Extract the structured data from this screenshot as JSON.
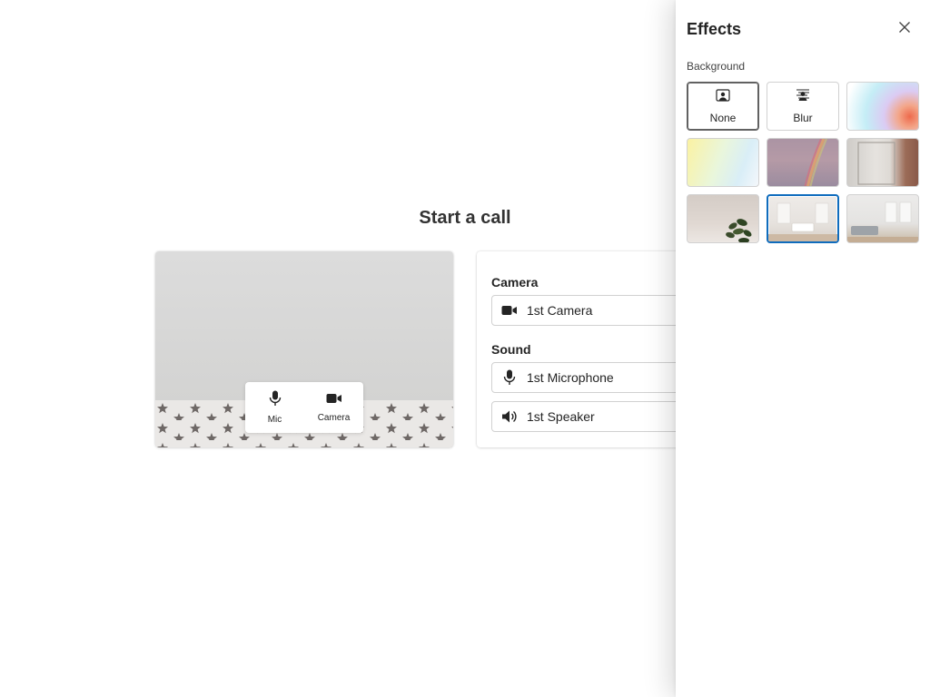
{
  "page": {
    "title": "Start a call"
  },
  "preview_controls": {
    "mic_label": "Mic",
    "camera_label": "Camera"
  },
  "settings": {
    "camera_section": "Camera",
    "camera_value": "1st Camera",
    "sound_section": "Sound",
    "microphone_value": "1st Microphone",
    "speaker_value": "1st Speaker"
  },
  "effects": {
    "title": "Effects",
    "background_label": "Background",
    "options": [
      {
        "label": "None",
        "icon": "person-frame-icon",
        "selected": true
      },
      {
        "label": "Blur",
        "icon": "blur-icon",
        "selected": false
      }
    ],
    "images": [
      {
        "name": "gradient-blue-orange",
        "selected": false
      },
      {
        "name": "pastel-gradient",
        "selected": false
      },
      {
        "name": "rainbow-sky",
        "selected": false
      },
      {
        "name": "mirror-room",
        "selected": false
      },
      {
        "name": "plant-wall",
        "selected": false
      },
      {
        "name": "white-bedroom",
        "selected": true
      },
      {
        "name": "living-room",
        "selected": false
      }
    ]
  },
  "colors": {
    "accent": "#0f6cbd",
    "text": "#242424",
    "panel_bg": "#ffffff"
  }
}
